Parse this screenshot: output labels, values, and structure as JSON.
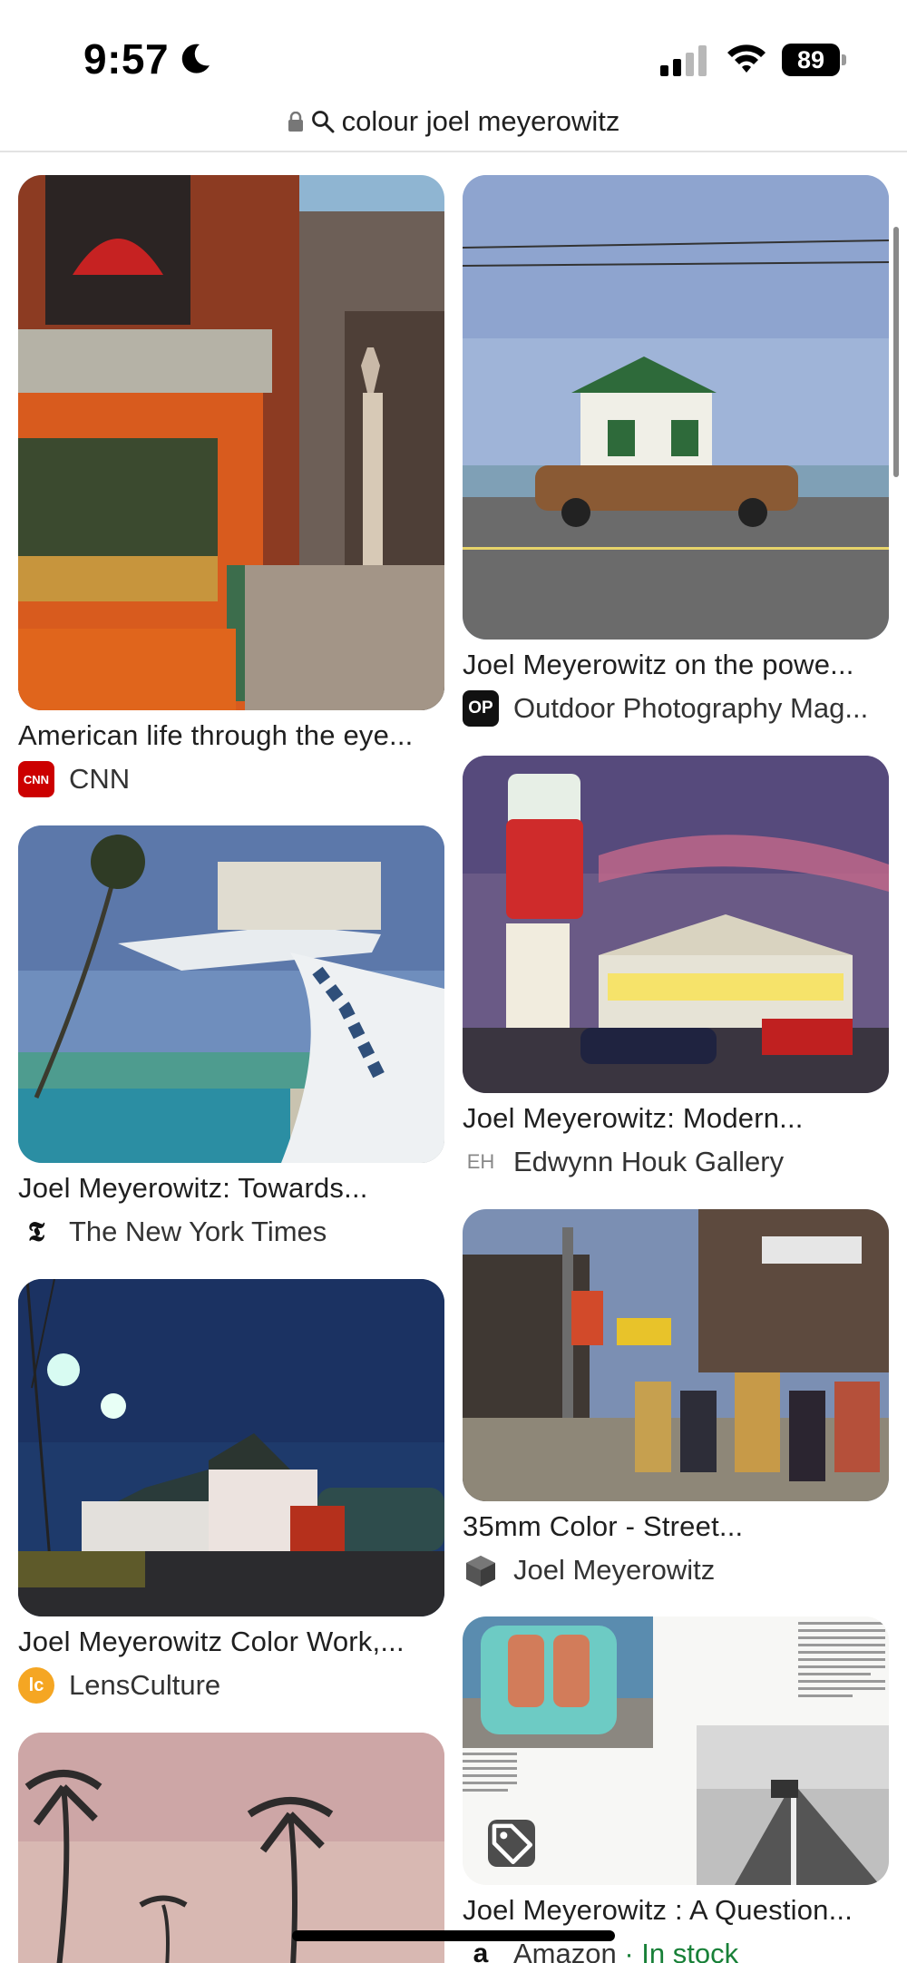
{
  "status_bar": {
    "time": "9:57",
    "battery": "89"
  },
  "url_bar": {
    "query": "colour joel meyerowitz"
  },
  "results": [
    {
      "title": "American life through the eye...",
      "source": "CNN",
      "favicon": "CNN"
    },
    {
      "title": "Joel Meyerowitz on the powe...",
      "source": "Outdoor Photography Mag...",
      "favicon": "OP"
    },
    {
      "title": "Joel Meyerowitz: Towards...",
      "source": "The New York Times",
      "favicon": "𝕿"
    },
    {
      "title": "Joel Meyerowitz: Modern...",
      "source": "Edwynn Houk Gallery",
      "favicon": "EH"
    },
    {
      "title": "Joel Meyerowitz Color Work,...",
      "source": "LensCulture",
      "favicon": "lc"
    },
    {
      "title": "35mm Color - Street...",
      "source": "Joel Meyerowitz",
      "favicon": "cube"
    },
    {
      "title": "Joel Meyerowitz : A Question...",
      "source": "Amazon",
      "stock": "· In stock",
      "favicon": "a"
    }
  ],
  "colors": {
    "cnn_red": "#cc0000",
    "lensculture_orange": "#f5a623",
    "in_stock_green": "#188038"
  }
}
